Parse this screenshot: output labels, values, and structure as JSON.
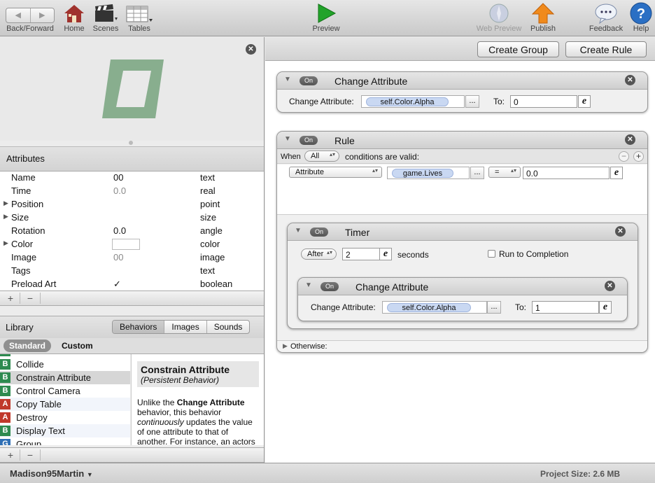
{
  "toolbar": {
    "back_forward": "Back/Forward",
    "home": "Home",
    "scenes": "Scenes",
    "tables": "Tables",
    "preview": "Preview",
    "web_preview": "Web Preview",
    "publish": "Publish",
    "feedback": "Feedback",
    "help": "Help"
  },
  "attributes": {
    "header": "Attributes",
    "rows": [
      {
        "name": "Name",
        "value": "00",
        "type": "text"
      },
      {
        "name": "Time",
        "value": "0.0",
        "type": "real"
      },
      {
        "name": "Position",
        "value": "",
        "type": "point"
      },
      {
        "name": "Size",
        "value": "",
        "type": "size"
      },
      {
        "name": "Rotation",
        "value": "0.0",
        "type": "angle"
      },
      {
        "name": "Color",
        "value": "",
        "type": "color"
      },
      {
        "name": "Image",
        "value": "00",
        "type": "image"
      },
      {
        "name": "Tags",
        "value": "",
        "type": "text"
      },
      {
        "name": "Preload Art",
        "value": "✓",
        "type": "boolean"
      }
    ]
  },
  "library": {
    "header": "Library",
    "tabs": [
      "Behaviors",
      "Images",
      "Sounds"
    ],
    "standard": "Standard",
    "custom": "Custom",
    "items": [
      {
        "badge": "B",
        "label": "Collide"
      },
      {
        "badge": "B",
        "label": "Constrain Attribute"
      },
      {
        "badge": "B",
        "label": "Control Camera"
      },
      {
        "badge": "A",
        "label": "Copy Table"
      },
      {
        "badge": "A",
        "label": "Destroy"
      },
      {
        "badge": "B",
        "label": "Display Text"
      },
      {
        "badge": "G",
        "label": "Group"
      }
    ],
    "desc_title": "Constrain Attribute",
    "desc_subtitle": "(Persistent Behavior)",
    "desc_p1": "Unlike the ",
    "desc_b1": "Change Attribute",
    "desc_p2": " behavior, this behavior ",
    "desc_i1": "continuously",
    "desc_p3": " updates the value of one attribute to that of another. For instance, an actors"
  },
  "bottom": {
    "user": "Madison95Martin",
    "project_size": "Project Size: 2.6 MB"
  },
  "editor": {
    "create_group": "Create Group",
    "create_rule": "Create Rule",
    "on": "On",
    "change1": {
      "title": "Change Attribute",
      "label": "Change Attribute:",
      "attr": "self.Color.Alpha",
      "to_label": "To:",
      "to_value": "0"
    },
    "rule": {
      "title": "Rule",
      "when": "When",
      "all": "All",
      "cond_text": "conditions are valid:",
      "cond_type": "Attribute",
      "cond_attr": "game.Lives",
      "op": "=",
      "value": "0.0",
      "otherwise": "Otherwise:"
    },
    "timer": {
      "title": "Timer",
      "mode": "After",
      "value": "2",
      "seconds": "seconds",
      "run_label": "Run to Completion"
    },
    "change2": {
      "title": "Change Attribute",
      "label": "Change Attribute:",
      "attr": "self.Color.Alpha",
      "to_label": "To:",
      "to_value": "1"
    }
  }
}
